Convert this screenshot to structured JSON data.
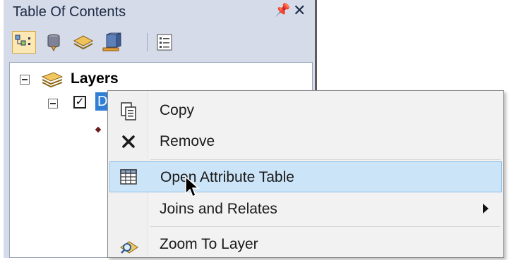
{
  "toc": {
    "title": "Table Of Contents",
    "pin_glyph": "↑",
    "close_glyph": "✕",
    "toolbar": [
      {
        "icon": "list-by-drawing-order-icon",
        "selected": true
      },
      {
        "icon": "list-by-source-icon"
      },
      {
        "icon": "list-by-visibility-icon"
      },
      {
        "icon": "list-by-selection-icon"
      },
      {
        "icon": "options-icon"
      }
    ],
    "tree": {
      "root_label": "Layers",
      "layer_label": "D",
      "layer_checked": "✓"
    }
  },
  "context_menu": {
    "items": [
      {
        "label": "Copy",
        "icon": "copy-icon"
      },
      {
        "label": "Remove",
        "icon": "remove-x-icon"
      },
      {
        "label": "Open Attribute Table",
        "icon": "table-icon",
        "highlighted": true
      },
      {
        "label": "Joins and Relates",
        "submenu": true
      },
      {
        "label": "Zoom To Layer",
        "icon": "zoom-to-layer-icon"
      }
    ]
  },
  "colors": {
    "panel_bg": "#d6dbe9",
    "selection_blue": "#2f7fd6",
    "menu_hover": "#cce4f7"
  }
}
